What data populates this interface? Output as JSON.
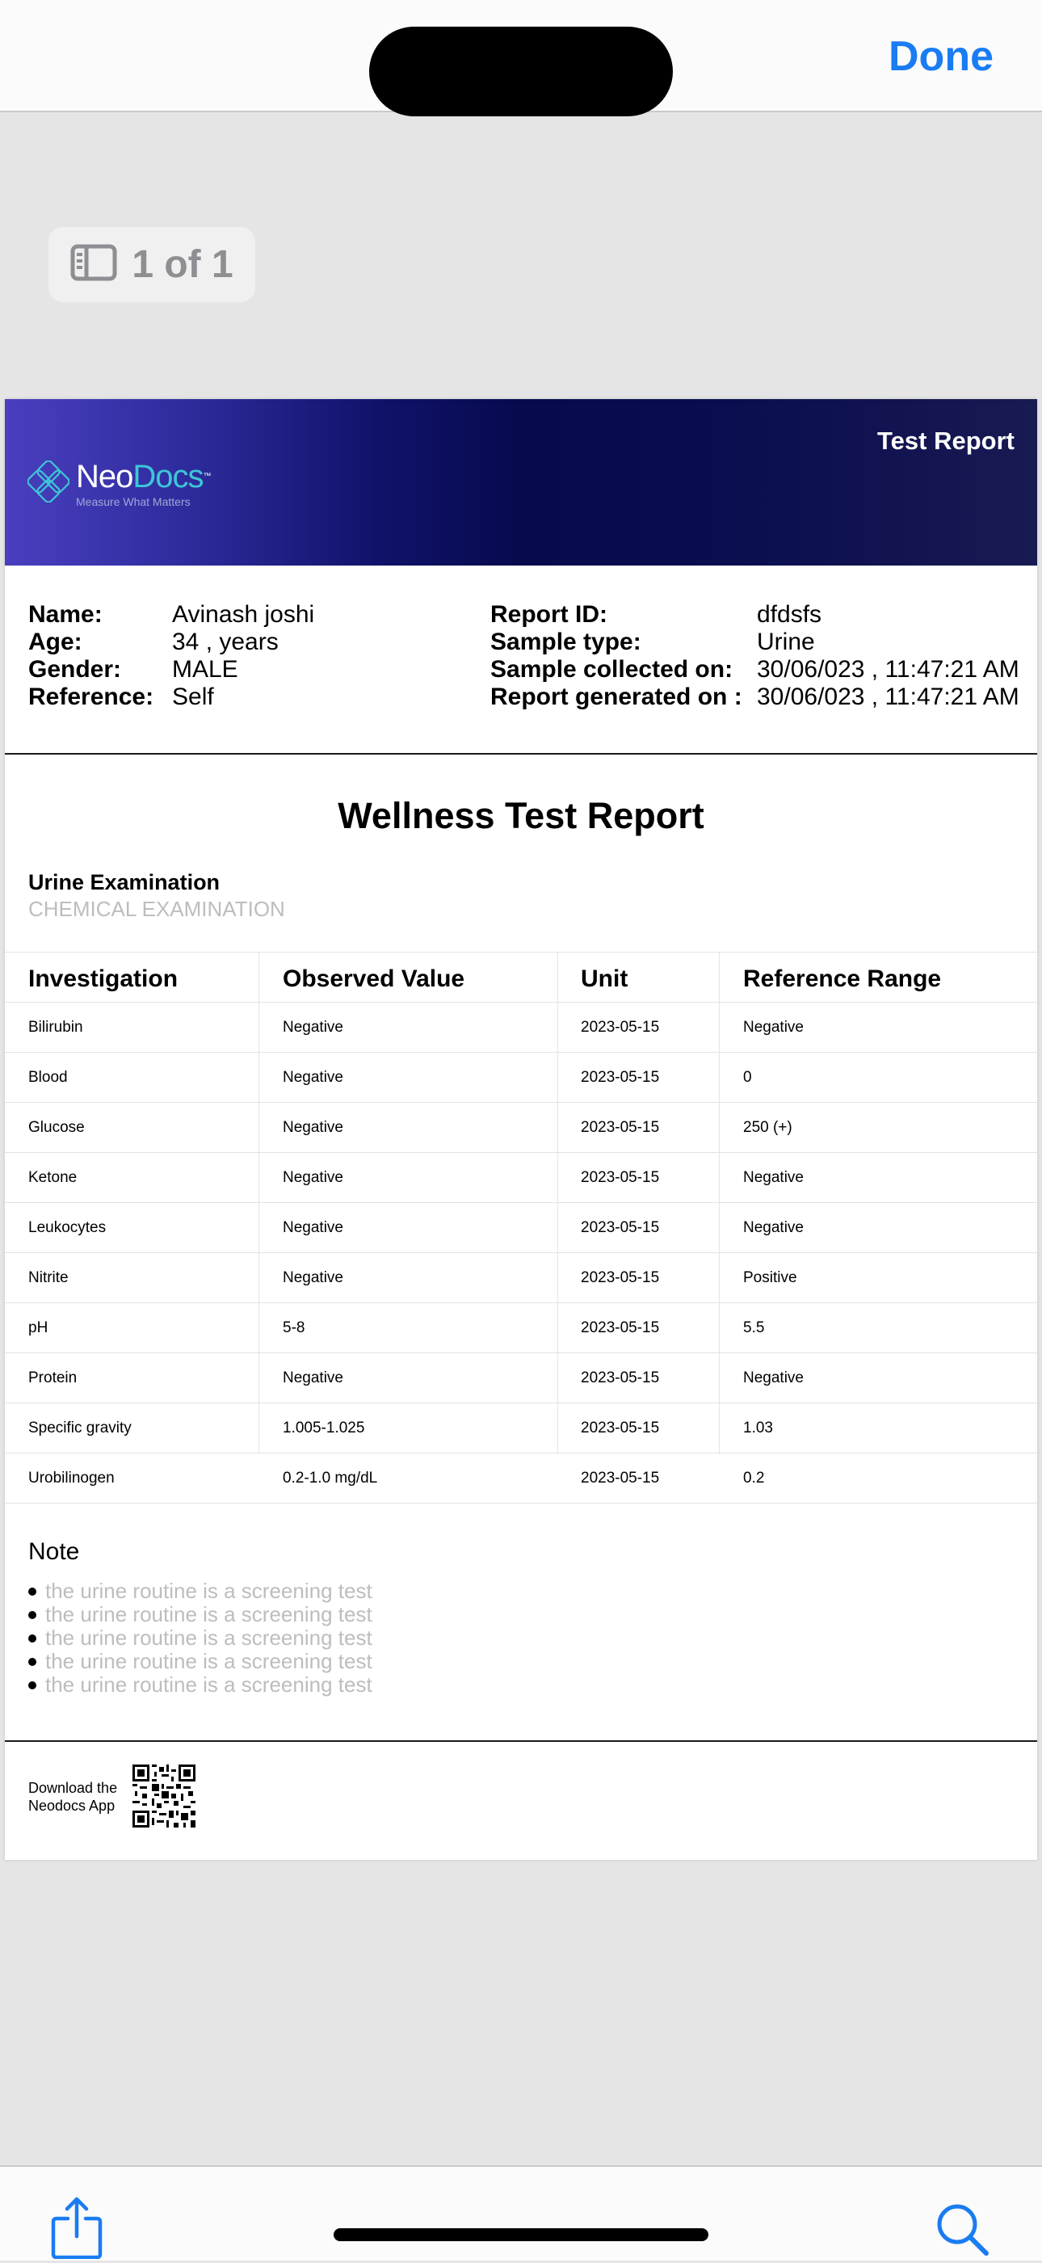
{
  "toolbar": {
    "done_label": "Done"
  },
  "page_indicator": {
    "text": "1 of 1",
    "icon": "sidebar-icon"
  },
  "report": {
    "header": {
      "logo_neo": "Neo",
      "logo_docs": "Docs",
      "logo_tm": "™",
      "logo_tagline": "Measure What Matters",
      "label": "Test Report",
      "colors": {
        "gradient_start": "#4a3fbf",
        "gradient_mid": "#070a4d",
        "gradient_end": "#181a52",
        "logo_accent": "#3ec6d6"
      }
    },
    "patient": {
      "left": [
        {
          "label": "Name:",
          "value": "Avinash joshi"
        },
        {
          "label": "Age:",
          "value": "34 , years"
        },
        {
          "label": "Gender:",
          "value": "MALE"
        },
        {
          "label": "Reference:",
          "value": "Self"
        }
      ],
      "right": [
        {
          "label": "Report ID:",
          "value": "dfdsfs"
        },
        {
          "label": "Sample type:",
          "value": "Urine"
        },
        {
          "label": "Sample collected on:",
          "value": "30/06/023 , 11:47:21 AM"
        },
        {
          "label": "Report generated on :",
          "value": "30/06/023 , 11:47:21 AM"
        }
      ]
    },
    "title": "Wellness Test Report",
    "section_title": "Urine Examination",
    "section_subtitle": "CHEMICAL EXAMINATION",
    "table": {
      "headers": [
        "Investigation",
        "Observed Value",
        "Unit",
        "Reference Range"
      ],
      "rows": [
        [
          "Bilirubin",
          "Negative",
          "2023-05-15",
          "Negative"
        ],
        [
          "Blood",
          "Negative",
          "2023-05-15",
          "0"
        ],
        [
          "Glucose",
          "Negative",
          "2023-05-15",
          "250 (+)"
        ],
        [
          "Ketone",
          "Negative",
          "2023-05-15",
          "Negative"
        ],
        [
          "Leukocytes",
          "Negative",
          "2023-05-15",
          "Negative"
        ],
        [
          "Nitrite",
          "Negative",
          "2023-05-15",
          "Positive"
        ],
        [
          "pH",
          "5-8",
          "2023-05-15",
          "5.5"
        ],
        [
          "Protein",
          "Negative",
          "2023-05-15",
          "Negative"
        ],
        [
          "Specific gravity",
          "1.005-1.025",
          "2023-05-15",
          "1.03"
        ],
        [
          "Urobilinogen",
          "0.2-1.0 mg/dL",
          "2023-05-15",
          "0.2"
        ]
      ]
    },
    "note": {
      "title": "Note",
      "items": [
        "the urine routine is a screening test",
        "the urine routine is a screening test",
        "the urine routine is a screening test",
        "the urine routine is a screening test",
        "the urine routine is a screening test"
      ]
    },
    "footer": {
      "line1": "Download the",
      "line2": "Neodocs App",
      "qr": "qr-code"
    }
  },
  "bottom_toolbar": {
    "share_icon": "share-icon",
    "search_icon": "search-icon"
  },
  "colors": {
    "accent": "#1a7cf2",
    "background": "#e5e5e5",
    "muted_text": "#bdbdbd"
  }
}
